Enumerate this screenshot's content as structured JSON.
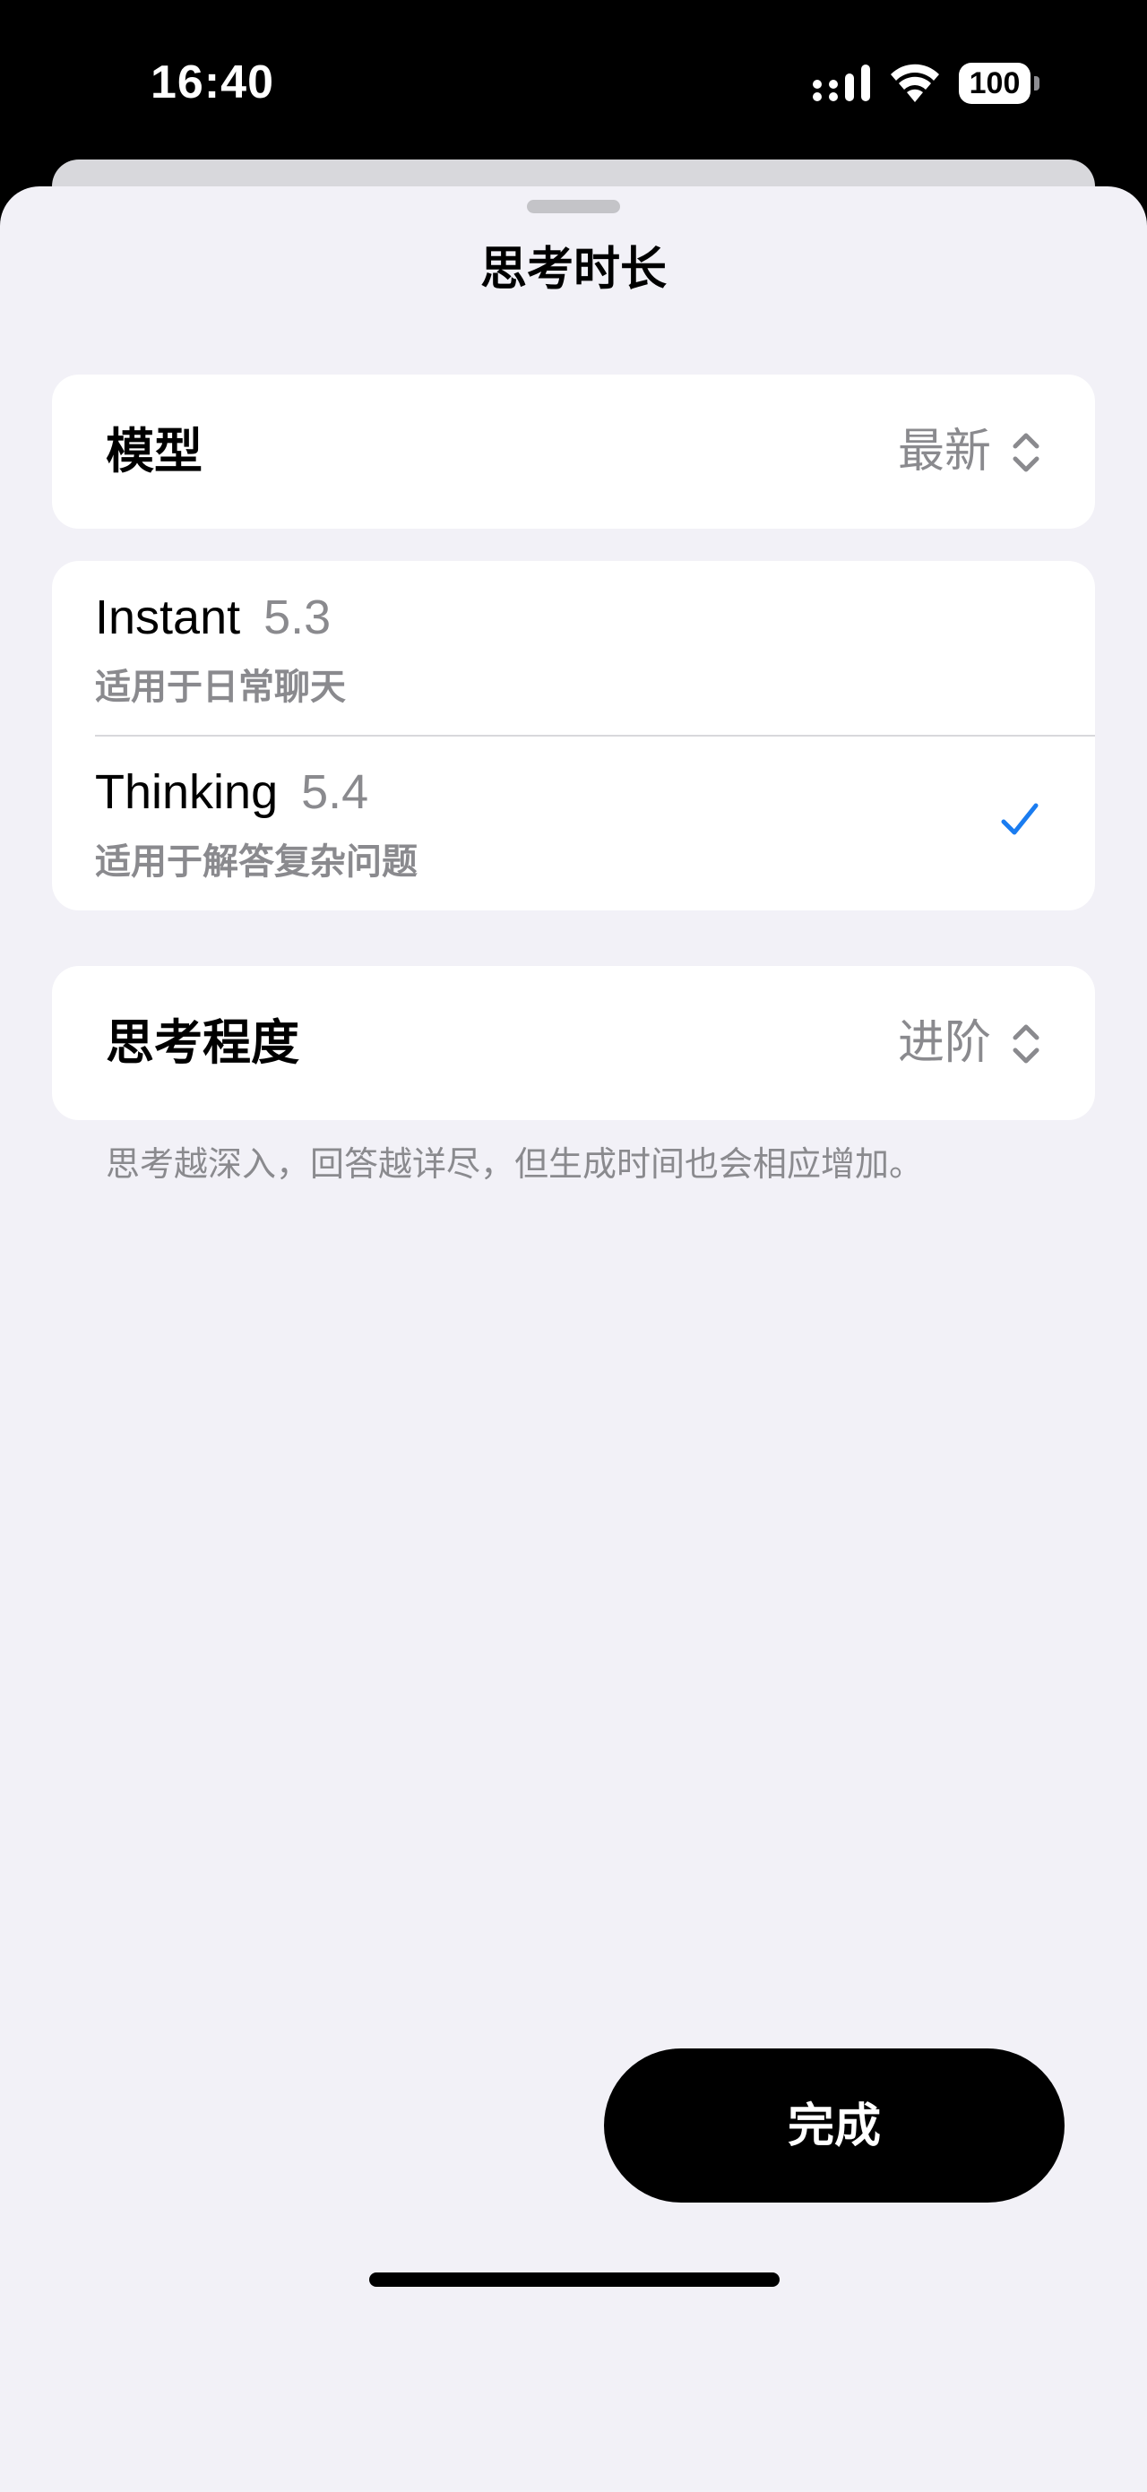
{
  "status_bar": {
    "time": "16:40",
    "battery": "100",
    "icons": [
      "signal-icon",
      "wifi-icon",
      "battery-icon"
    ]
  },
  "sheet": {
    "title": "思考时长",
    "model_row": {
      "label": "模型",
      "value": "最新"
    },
    "options": [
      {
        "name": "Instant",
        "version": "5.3",
        "description": "适用于日常聊天",
        "selected": false
      },
      {
        "name": "Thinking",
        "version": "5.4",
        "description": "适用于解答复杂问题",
        "selected": true
      }
    ],
    "effort_row": {
      "label": "思考程度",
      "value": "进阶"
    },
    "footnote": "思考越深入，回答越详尽，但生成时间也会相应增加。",
    "done_label": "完成"
  },
  "colors": {
    "accent": "#1a7cf0",
    "sheet_background": "#f2f1f7",
    "secondary_text": "#8a8a8e"
  }
}
